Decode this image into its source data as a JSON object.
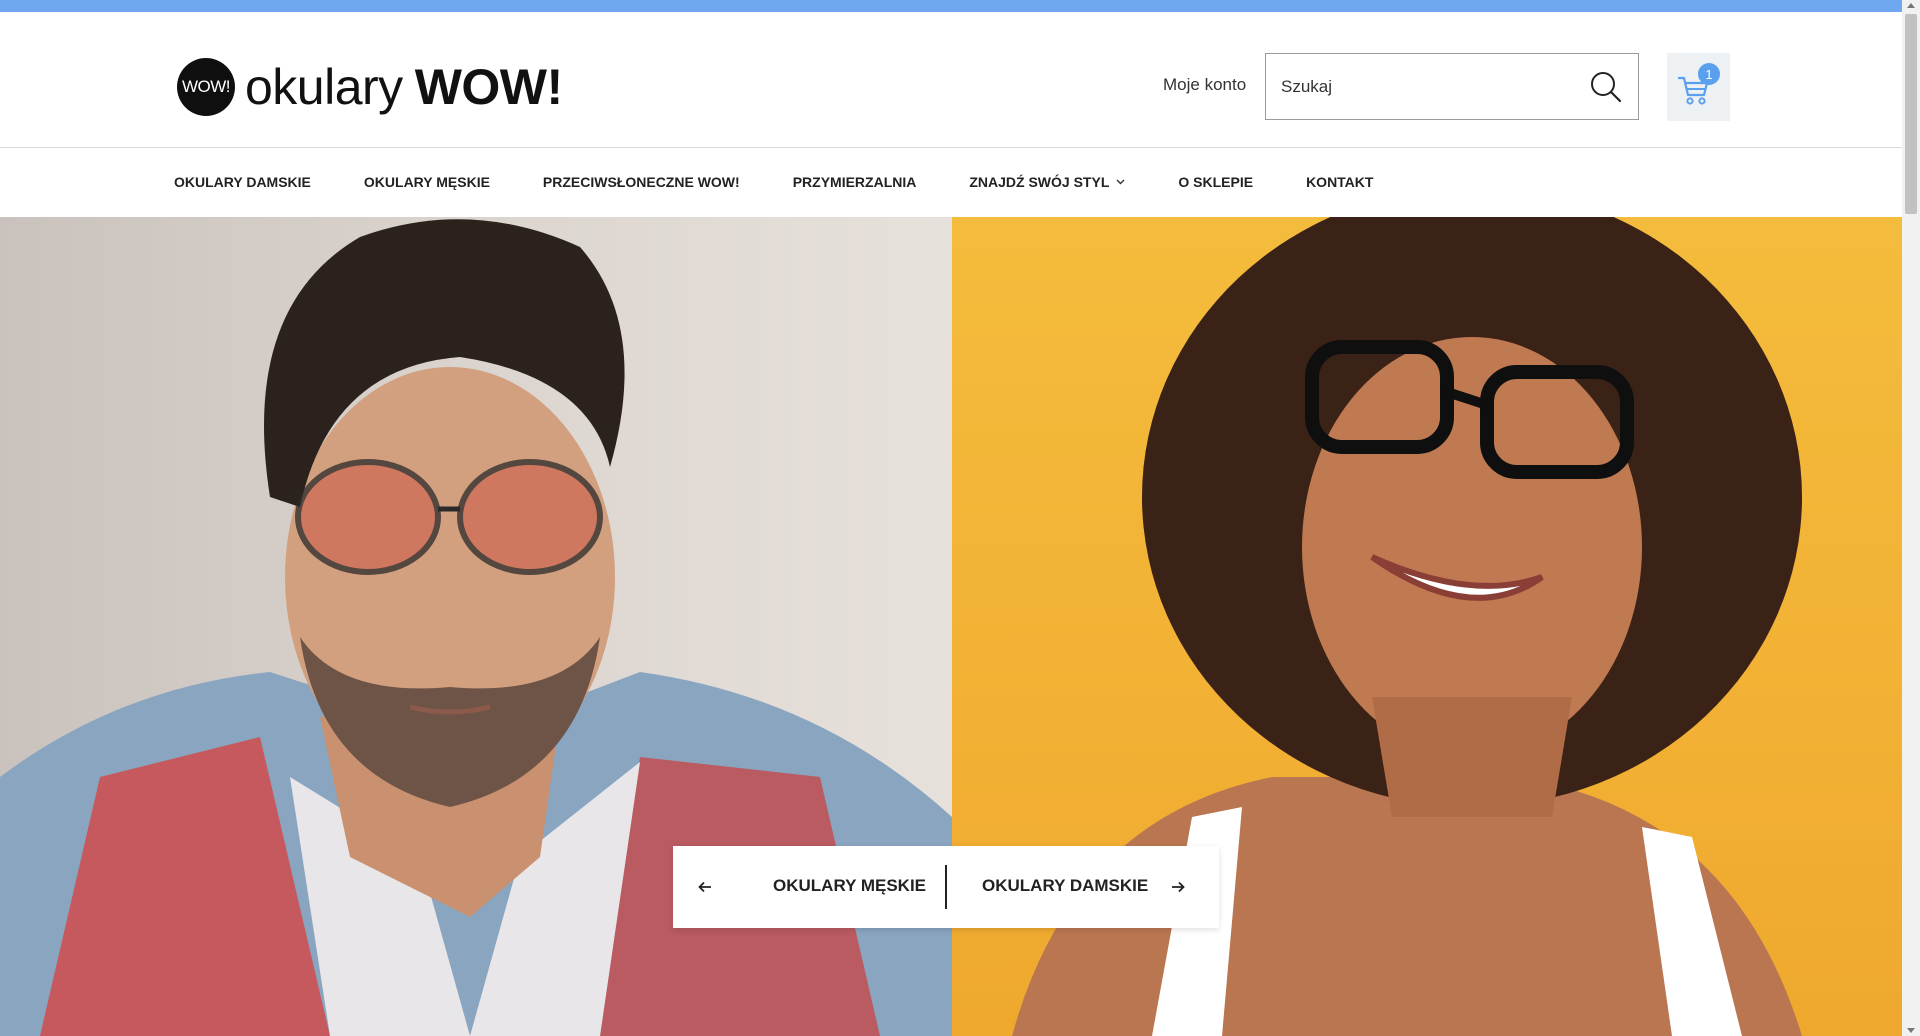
{
  "brand": {
    "badge_text": "WOW!",
    "name_light": "okulary",
    "name_bold": "WOW!"
  },
  "header": {
    "account_label": "Moje konto",
    "search_placeholder": "Szukaj",
    "cart_count": "1"
  },
  "nav": {
    "items": [
      {
        "label": "OKULARY DAMSKIE"
      },
      {
        "label": "OKULARY MĘSKIE"
      },
      {
        "label": "PRZECIWSŁONECZNE WOW!"
      },
      {
        "label": "PRZYMIERZALNIA"
      },
      {
        "label": "ZNAJDŹ SWÓJ STYL"
      },
      {
        "label": "O SKLEPIE"
      },
      {
        "label": "KONTAKT"
      }
    ]
  },
  "hero": {
    "left_label": "OKULARY MĘSKIE",
    "right_label": "OKULARY DAMSKIE"
  },
  "colors": {
    "top_strip": "#6fa8f0",
    "cart_badge": "#5aa0ef",
    "hero_right": "#f2b134"
  },
  "icons": {
    "search": "search-icon",
    "cart": "cart-icon",
    "dropdown": "chevron-down-icon",
    "prev": "arrow-left-icon",
    "next": "arrow-right-icon"
  }
}
